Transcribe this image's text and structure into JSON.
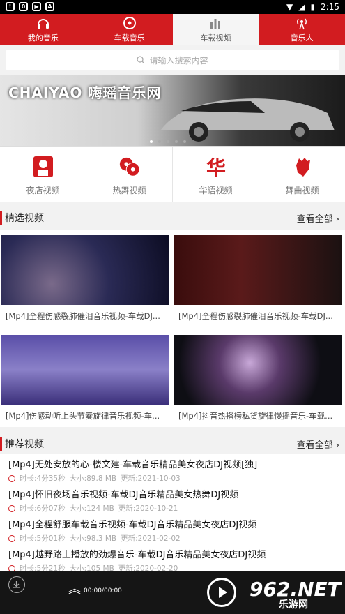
{
  "status_bar": {
    "time": "2:15"
  },
  "tabs": [
    {
      "label": "我的音乐"
    },
    {
      "label": "车载音乐"
    },
    {
      "label": "车载视频"
    },
    {
      "label": "音乐人"
    }
  ],
  "search": {
    "placeholder": "请输入搜索内容"
  },
  "banner": {
    "text": "CHAIYAO 嗨瑶音乐网"
  },
  "categories": [
    {
      "label": "夜店视频"
    },
    {
      "label": "热舞视频"
    },
    {
      "label": "华语视频"
    },
    {
      "label": "舞曲视频"
    }
  ],
  "featured": {
    "title": "精选视频",
    "more": "查看全部 ›",
    "items": [
      {
        "caption": "[Mp4]全程伤感裂肺催泪音乐视频-车载DJ..."
      },
      {
        "caption": "[Mp4]全程伤感裂肺催泪音乐视频-车载DJ..."
      },
      {
        "caption": "[Mp4]伤感动听上头节奏旋律音乐视频-车..."
      },
      {
        "caption": "[Mp4]抖音热播榜私货旋律慢摇音乐-车载..."
      }
    ]
  },
  "recommend": {
    "title": "推荐视频",
    "more": "查看全部 ›",
    "items": [
      {
        "title": "[Mp4]无处安放的心-楼文建-车载音乐精品美女夜店DJ视频[独]",
        "duration": "时长:4分35秒",
        "size": "大小:89.8 MB",
        "updated": "更新:2021-10-03"
      },
      {
        "title": "[Mp4]怀旧夜场音乐视频-车载DJ音乐精品美女热舞DJ视频",
        "duration": "时长:6分07秒",
        "size": "大小:124 MB",
        "updated": "更新:2020-10-21"
      },
      {
        "title": "[Mp4]全程舒服车载音乐视频-车载DJ音乐精品美女夜店DJ视频",
        "duration": "时长:5分01秒",
        "size": "大小:98.3 MB",
        "updated": "更新:2021-02-02"
      },
      {
        "title": "[Mp4]越野路上播放的劲爆音乐-车载DJ音乐精品美女夜店DJ视频",
        "duration": "时长:5分21秒",
        "size": "大小:105 MB",
        "updated": "更新:2020-02-20"
      }
    ]
  },
  "player": {
    "time": "00:00/00:00",
    "watermark": "962.NET",
    "watermark_sub": "乐游网"
  }
}
